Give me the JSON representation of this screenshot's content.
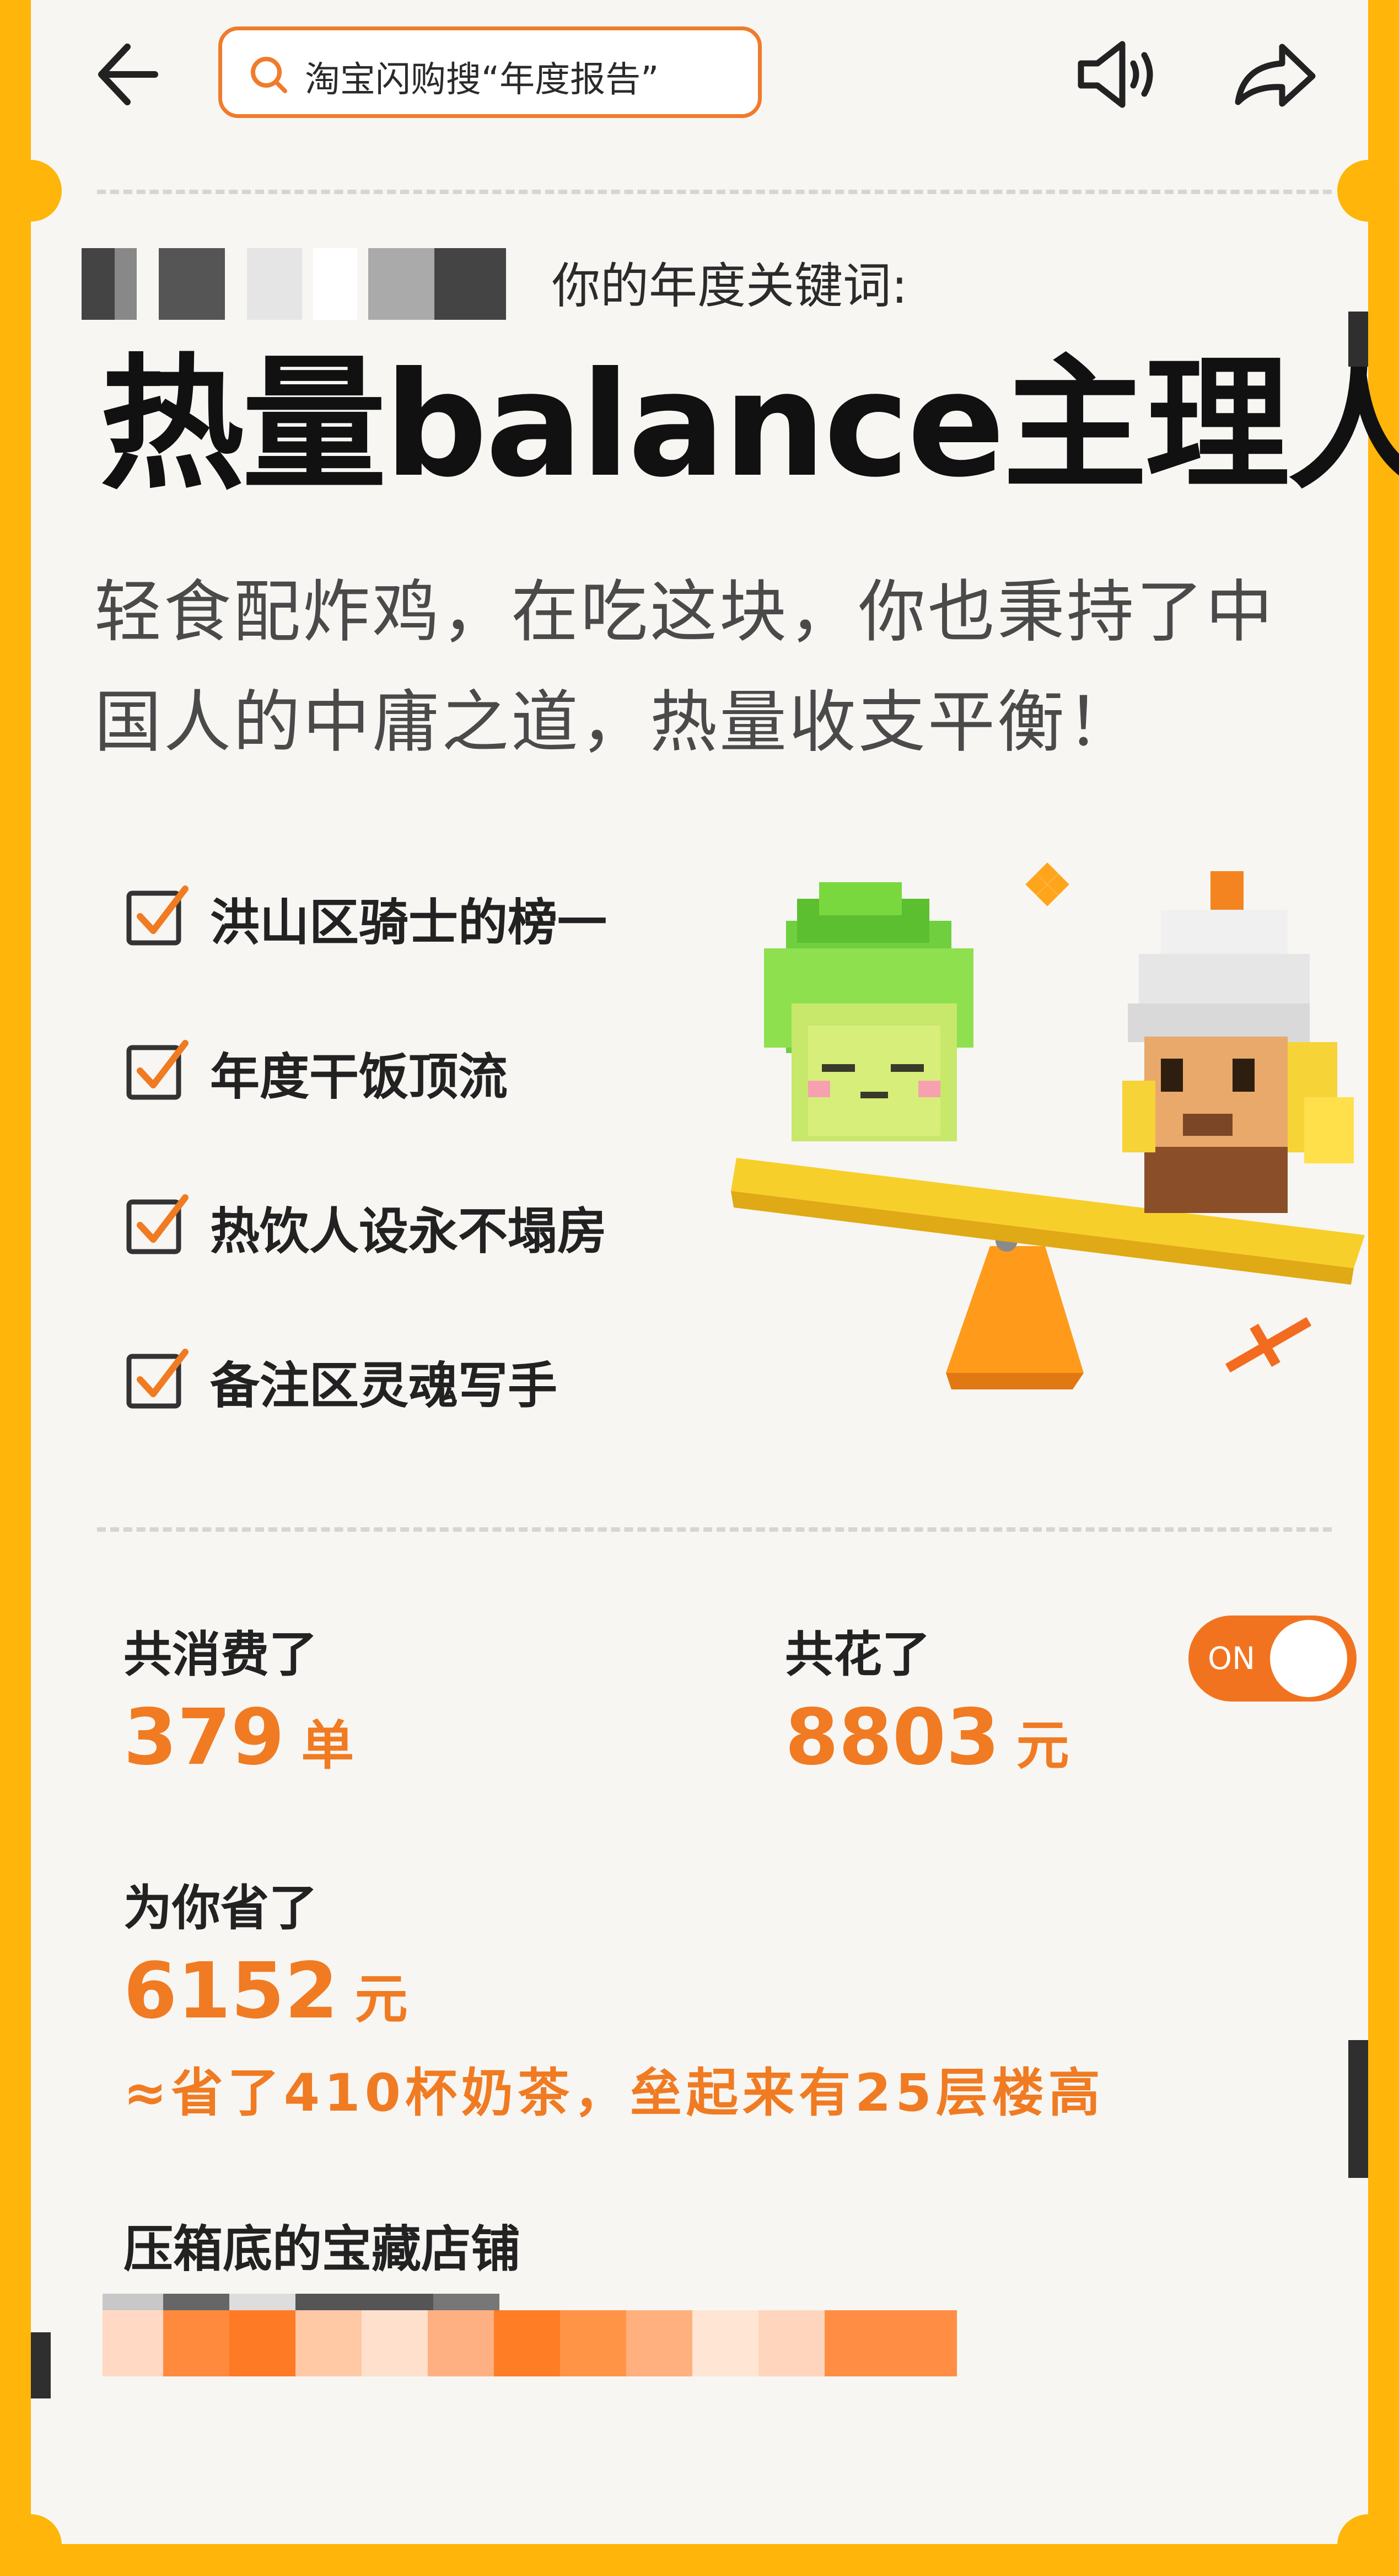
{
  "topbar": {
    "search_placeholder": "淘宝闪购搜“年度报告”",
    "icons": [
      "back-arrow-icon",
      "search-icon",
      "sound-icon",
      "share-icon"
    ]
  },
  "keyword_label": "你的年度关键词:",
  "keyword_title": "热量balance主理人",
  "description": "轻食配炸鸡，在吃这块，你也秉持了中国人的中庸之道，热量收支平衡！",
  "checklist": [
    {
      "label": "洪山区骑士的榜一"
    },
    {
      "label": "年度干饭顶流"
    },
    {
      "label": "热饮人设永不塌房"
    },
    {
      "label": "备注区灵魂写手"
    }
  ],
  "stats": {
    "orders_label": "共消费了",
    "orders_value": "379",
    "orders_unit": "单",
    "spent_label": "共花了",
    "spent_value": "8803",
    "spent_unit": "元",
    "saved_label": "为你省了",
    "saved_value": "6152",
    "saved_unit": "元",
    "milk_tea_text": "≈省了410杯奶茶，垒起来有25层楼高"
  },
  "toggle": {
    "label": "ON",
    "state": "on"
  },
  "shop_label": "压箱底的宝藏店铺",
  "colors": {
    "accent": "#f07b22",
    "frame": "#ffb509",
    "paper": "#f7f6f3"
  }
}
